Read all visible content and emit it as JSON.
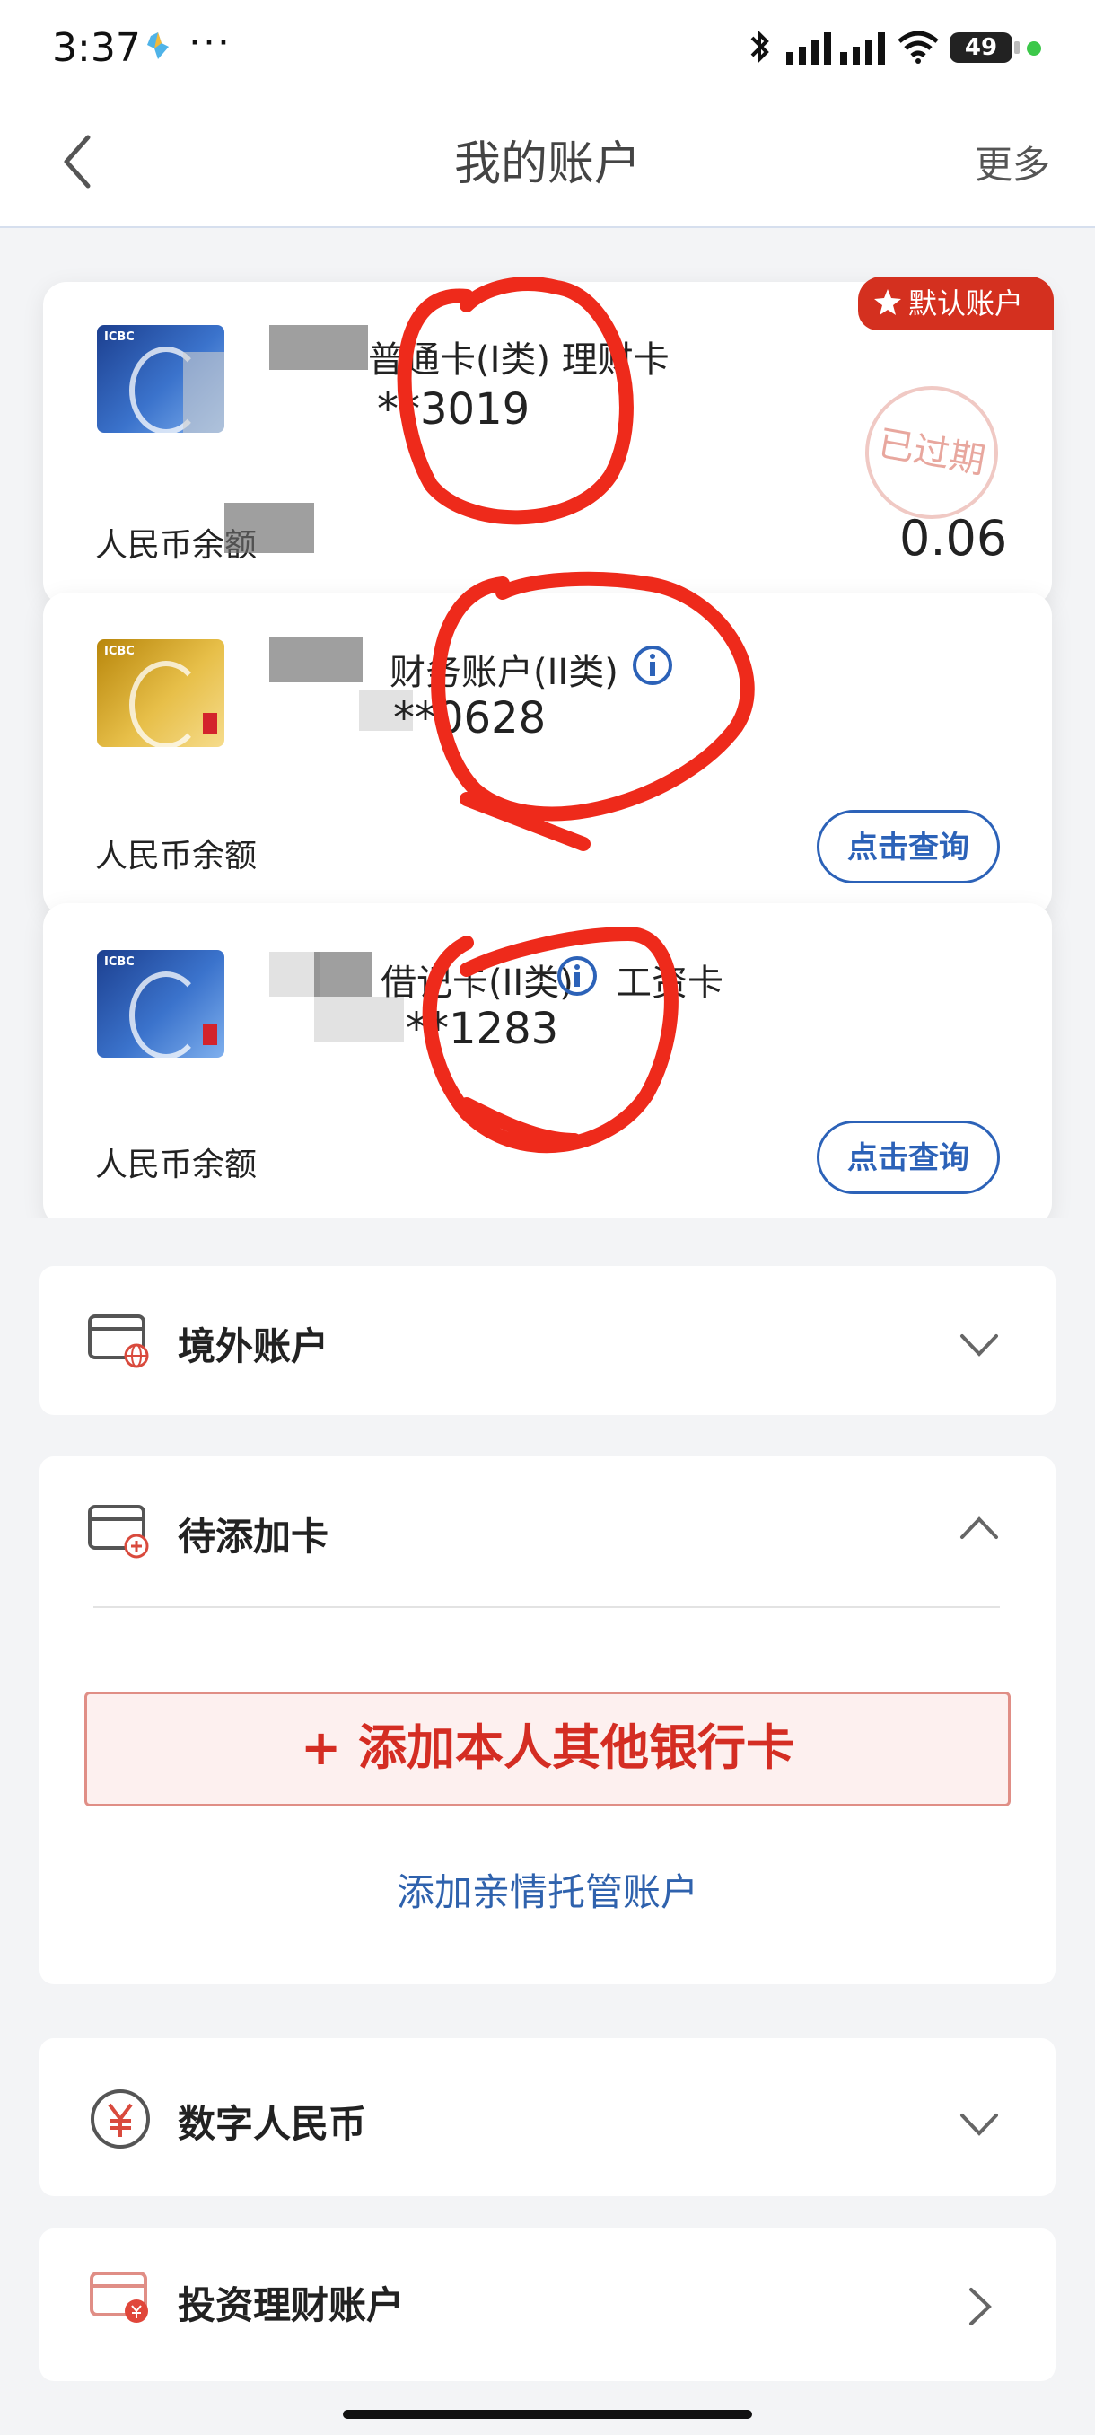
{
  "status_bar": {
    "time": "3:37",
    "dots": "···",
    "battery": "49"
  },
  "nav": {
    "title": "我的账户",
    "more": "更多"
  },
  "cards": [
    {
      "name": "普通卡(I类) 理财卡",
      "number": "**3019",
      "balance_label": "人民币余额",
      "balance": "0.06",
      "badge": "默认账户",
      "stamp": "已过期",
      "bank_text": "ICBC"
    },
    {
      "name": "财务账户(II类)",
      "number": "**0628",
      "balance_label": "人民币余额",
      "button": "点击查询",
      "bank_text": "ICBC"
    },
    {
      "name": "借记卡(II类)",
      "tag": "工资卡",
      "number": "**1283",
      "balance_label": "人民币余额",
      "button": "点击查询",
      "bank_text": "ICBC"
    }
  ],
  "sections": {
    "overseas": "境外账户",
    "pending": "待添加卡",
    "add_button": "+ 添加本人其他银行卡",
    "add_family": "添加亲情托管账户",
    "digital_rmb": "数字人民币",
    "investment": "投资理财账户"
  },
  "colors": {
    "accent_red": "#d42d23",
    "link_blue": "#2f62ad",
    "badge_red": "#d4301f"
  }
}
